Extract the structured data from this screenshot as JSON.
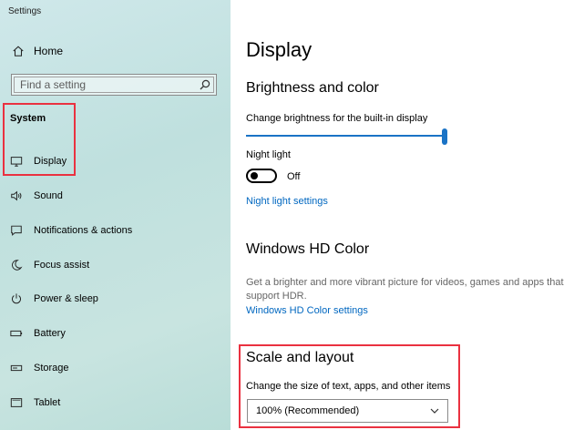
{
  "window": {
    "title": "Settings"
  },
  "sidebar": {
    "home_label": "Home",
    "search_placeholder": "Find a setting",
    "section_label": "System",
    "items": [
      {
        "label": "Display",
        "icon": "monitor-icon"
      },
      {
        "label": "Sound",
        "icon": "speaker-icon"
      },
      {
        "label": "Notifications & actions",
        "icon": "notification-icon"
      },
      {
        "label": "Focus assist",
        "icon": "moon-icon"
      },
      {
        "label": "Power & sleep",
        "icon": "power-icon"
      },
      {
        "label": "Battery",
        "icon": "battery-icon"
      },
      {
        "label": "Storage",
        "icon": "storage-icon"
      },
      {
        "label": "Tablet",
        "icon": "tablet-icon"
      }
    ]
  },
  "main": {
    "page_title": "Display",
    "brightness": {
      "heading": "Brightness and color",
      "slider_label": "Change brightness for the built-in display",
      "brightness_value_percent": 100,
      "night_light_label": "Night light",
      "night_light_state": "Off",
      "night_light_on": false,
      "night_light_settings_link": "Night light settings"
    },
    "hdr": {
      "heading": "Windows HD Color",
      "description": "Get a brighter and more vibrant picture for videos, games and apps that support HDR.",
      "settings_link": "Windows HD Color settings"
    },
    "scale": {
      "heading": "Scale and layout",
      "label": "Change the size of text, apps, and other items",
      "selected_value": "100% (Recommended)"
    }
  },
  "colors": {
    "accent": "#0067c0",
    "slider": "#1a73c6",
    "highlight": "#ea3140"
  }
}
